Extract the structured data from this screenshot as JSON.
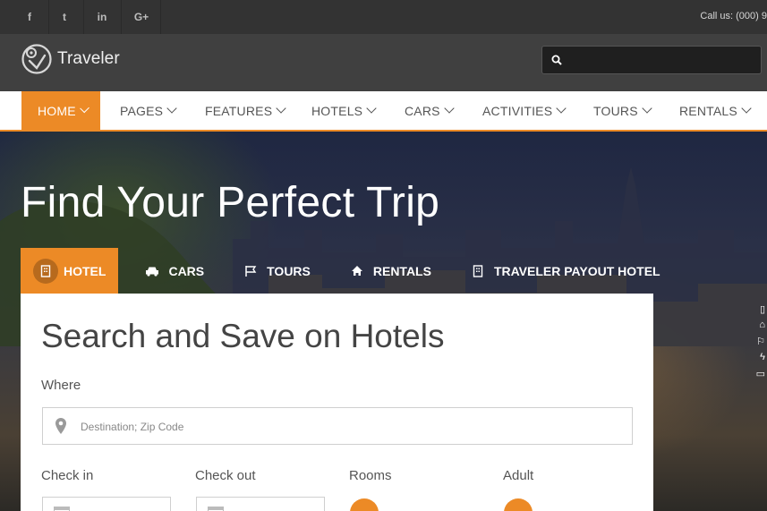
{
  "topbar": {
    "social": [
      {
        "icon": "facebook-icon",
        "glyph": "f"
      },
      {
        "icon": "twitter-icon",
        "glyph": "t"
      },
      {
        "icon": "linkedin-icon",
        "glyph": "in"
      },
      {
        "icon": "google-plus-icon",
        "glyph": "G+"
      }
    ],
    "call_text": "Call us: (000) 9"
  },
  "header": {
    "brand": "Traveler",
    "search": {
      "placeholder": "",
      "icon": "search-icon"
    }
  },
  "nav": {
    "items": [
      {
        "label": "HOME",
        "active": true
      },
      {
        "label": "PAGES"
      },
      {
        "label": "FEATURES"
      },
      {
        "label": "HOTELS"
      },
      {
        "label": "CARS"
      },
      {
        "label": "ACTIVITIES"
      },
      {
        "label": "TOURS"
      },
      {
        "label": "RENTALS"
      }
    ]
  },
  "hero": {
    "title": "Find Your Perfect Trip",
    "tabs": [
      {
        "label": "HOTEL",
        "icon": "building-icon",
        "active": true
      },
      {
        "label": "CARS",
        "icon": "car-icon"
      },
      {
        "label": "TOURS",
        "icon": "flag-icon"
      },
      {
        "label": "RENTALS",
        "icon": "home-icon"
      },
      {
        "label": "TRAVELER PAYOUT HOTEL",
        "icon": "building-icon"
      }
    ]
  },
  "search_form": {
    "title": "Search and Save on Hotels",
    "where_label": "Where",
    "where_placeholder": "Destination; Zip Code",
    "checkin_label": "Check in",
    "checkout_label": "Check out",
    "rooms_label": "Rooms",
    "adult_label": "Adult"
  },
  "colors": {
    "accent": "#ec8a26",
    "topbar": "#333333",
    "header": "#404040"
  }
}
